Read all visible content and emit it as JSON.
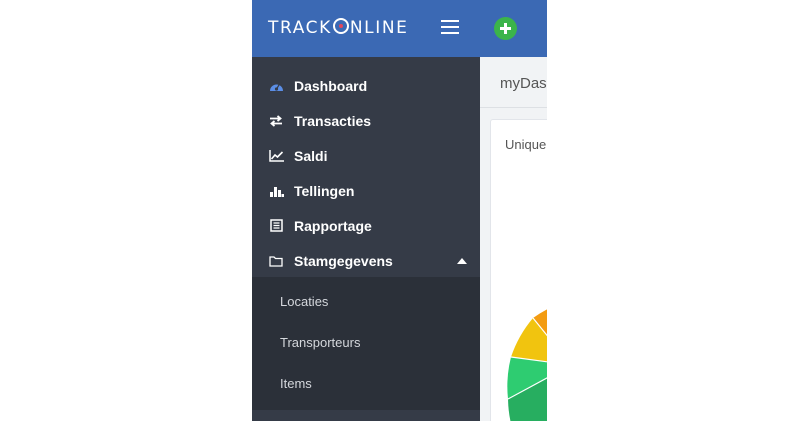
{
  "brand": {
    "part1": "TRACK",
    "part2": "NLINE"
  },
  "sidebar": {
    "items": [
      {
        "label": "Dashboard",
        "icon": "dashboard-icon",
        "icon_color": "#5b8ee6"
      },
      {
        "label": "Transacties",
        "icon": "exchange-icon"
      },
      {
        "label": "Saldi",
        "icon": "line-chart-icon"
      },
      {
        "label": "Tellingen",
        "icon": "bar-chart-icon"
      },
      {
        "label": "Rapportage",
        "icon": "report-icon"
      },
      {
        "label": "Stamgegevens",
        "icon": "folder-icon",
        "expanded": true
      }
    ],
    "subitems": [
      {
        "label": "Locaties"
      },
      {
        "label": "Transporteurs"
      },
      {
        "label": "Items"
      }
    ]
  },
  "content": {
    "page_title": "myDas",
    "card_title": "Unique"
  },
  "colors": {
    "header": "#3b69b4",
    "sidebar": "#353b47",
    "submenu": "#2b3039",
    "add_button": "#3bb44a",
    "gauge": [
      "#f39c12",
      "#f1c40f",
      "#2ecc71",
      "#27ae60"
    ]
  }
}
